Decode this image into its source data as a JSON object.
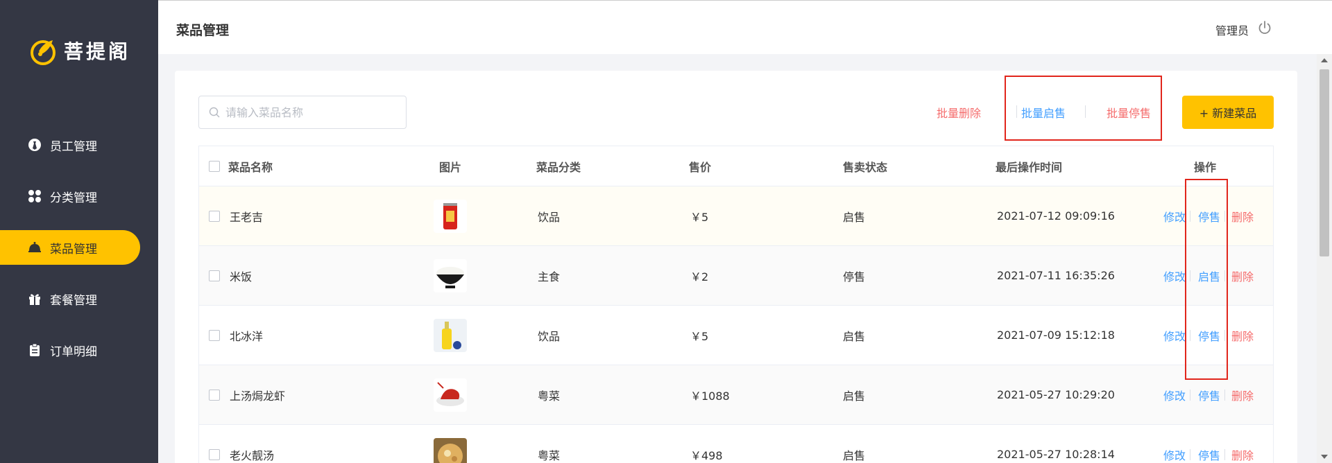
{
  "brand": {
    "name": "菩提阁"
  },
  "sidebar": {
    "items": [
      {
        "label": "员工管理",
        "icon": "employee-icon",
        "active": false
      },
      {
        "label": "分类管理",
        "icon": "category-icon",
        "active": false
      },
      {
        "label": "菜品管理",
        "icon": "dish-cloche-icon",
        "active": true
      },
      {
        "label": "套餐管理",
        "icon": "gift-icon",
        "active": false
      },
      {
        "label": "订单明细",
        "icon": "clipboard-icon",
        "active": false
      }
    ]
  },
  "header": {
    "title": "菜品管理",
    "user": "管理员"
  },
  "toolbar": {
    "search_placeholder": "请输入菜品名称",
    "batch_delete": "批量删除",
    "batch_enable": "批量启售",
    "batch_disable": "批量停售",
    "new_dish": "+ 新建菜品"
  },
  "table": {
    "columns": [
      "菜品名称",
      "图片",
      "菜品分类",
      "售价",
      "售卖状态",
      "最后操作时间",
      "操作"
    ],
    "rows": [
      {
        "name": "王老吉",
        "category": "饮品",
        "price": "￥5",
        "status": "启售",
        "time": "2021-07-12 09:09:16",
        "edit": "修改",
        "toggle": "停售",
        "delete": "删除"
      },
      {
        "name": "米饭",
        "category": "主食",
        "price": "￥2",
        "status": "停售",
        "time": "2021-07-11 16:35:26",
        "edit": "修改",
        "toggle": "启售",
        "delete": "删除"
      },
      {
        "name": "北冰洋",
        "category": "饮品",
        "price": "￥5",
        "status": "启售",
        "time": "2021-07-09 15:12:18",
        "edit": "修改",
        "toggle": "停售",
        "delete": "删除"
      },
      {
        "name": "上汤焗龙虾",
        "category": "粤菜",
        "price": "￥1088",
        "status": "启售",
        "time": "2021-05-27 10:29:20",
        "edit": "修改",
        "toggle": "停售",
        "delete": "删除"
      },
      {
        "name": "老火靓汤",
        "category": "粤菜",
        "price": "￥498",
        "status": "启售",
        "time": "2021-05-27 10:28:14",
        "edit": "修改",
        "toggle": "停售",
        "delete": "删除"
      }
    ]
  },
  "colors": {
    "sidebar": "#343744",
    "accent": "#ffc200",
    "link_blue": "#419eff",
    "danger_red": "#f56c6c",
    "highlight_box": "#e1251b"
  }
}
